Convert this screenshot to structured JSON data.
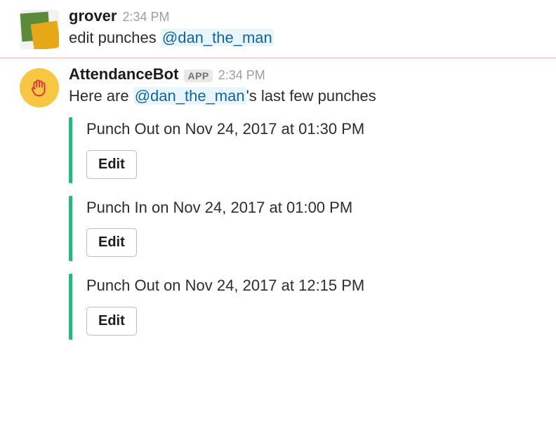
{
  "messages": [
    {
      "author": "grover",
      "timestamp": "2:34 PM",
      "command_prefix": "edit punches ",
      "mention": "@dan_the_man"
    },
    {
      "author": "AttendanceBot",
      "badge": "APP",
      "timestamp": "2:34 PM",
      "response_prefix": "Here are ",
      "mention": "@dan_the_man",
      "response_suffix": "'s last few punches",
      "punches": [
        {
          "text": "Punch Out on Nov 24, 2017 at 01:30 PM",
          "button": "Edit"
        },
        {
          "text": "Punch In on Nov 24, 2017 at 01:00 PM",
          "button": "Edit"
        },
        {
          "text": "Punch Out on Nov 24, 2017 at 12:15 PM",
          "button": "Edit"
        }
      ]
    }
  ]
}
